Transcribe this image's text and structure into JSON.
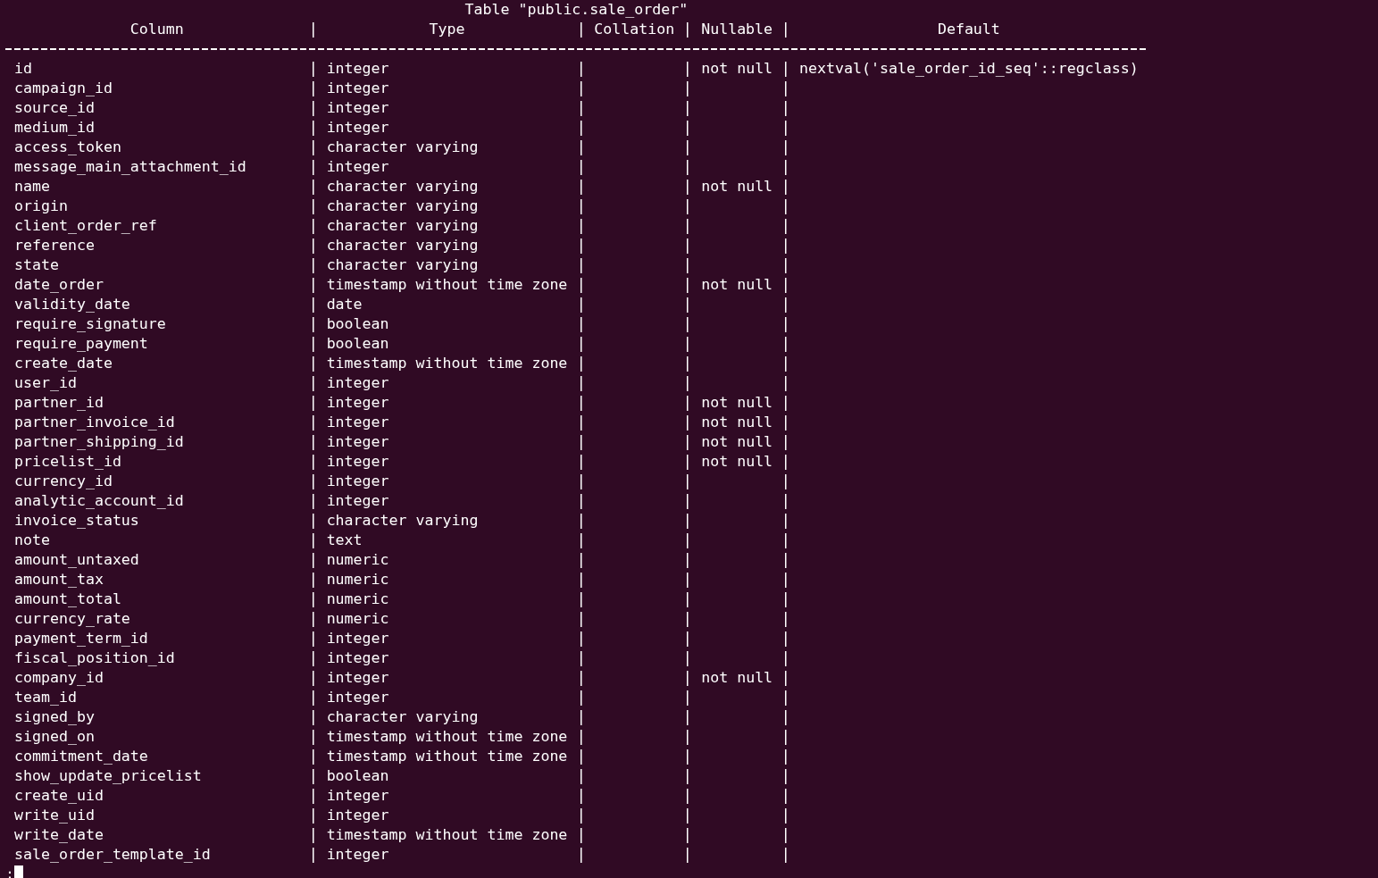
{
  "title": "Table \"public.sale_order\"",
  "columns": [
    "Column",
    "Type",
    "Collation",
    "Nullable",
    "Default"
  ],
  "rows": [
    {
      "column": "id",
      "type": "integer",
      "nullable": "not null",
      "default": "nextval('sale_order_id_seq'::regclass)"
    },
    {
      "column": "campaign_id",
      "type": "integer"
    },
    {
      "column": "source_id",
      "type": "integer"
    },
    {
      "column": "medium_id",
      "type": "integer"
    },
    {
      "column": "access_token",
      "type": "character varying"
    },
    {
      "column": "message_main_attachment_id",
      "type": "integer"
    },
    {
      "column": "name",
      "type": "character varying",
      "nullable": "not null"
    },
    {
      "column": "origin",
      "type": "character varying"
    },
    {
      "column": "client_order_ref",
      "type": "character varying"
    },
    {
      "column": "reference",
      "type": "character varying"
    },
    {
      "column": "state",
      "type": "character varying"
    },
    {
      "column": "date_order",
      "type": "timestamp without time zone",
      "nullable": "not null"
    },
    {
      "column": "validity_date",
      "type": "date"
    },
    {
      "column": "require_signature",
      "type": "boolean"
    },
    {
      "column": "require_payment",
      "type": "boolean"
    },
    {
      "column": "create_date",
      "type": "timestamp without time zone"
    },
    {
      "column": "user_id",
      "type": "integer"
    },
    {
      "column": "partner_id",
      "type": "integer",
      "nullable": "not null"
    },
    {
      "column": "partner_invoice_id",
      "type": "integer",
      "nullable": "not null"
    },
    {
      "column": "partner_shipping_id",
      "type": "integer",
      "nullable": "not null"
    },
    {
      "column": "pricelist_id",
      "type": "integer",
      "nullable": "not null"
    },
    {
      "column": "currency_id",
      "type": "integer"
    },
    {
      "column": "analytic_account_id",
      "type": "integer"
    },
    {
      "column": "invoice_status",
      "type": "character varying"
    },
    {
      "column": "note",
      "type": "text"
    },
    {
      "column": "amount_untaxed",
      "type": "numeric"
    },
    {
      "column": "amount_tax",
      "type": "numeric"
    },
    {
      "column": "amount_total",
      "type": "numeric"
    },
    {
      "column": "currency_rate",
      "type": "numeric"
    },
    {
      "column": "payment_term_id",
      "type": "integer"
    },
    {
      "column": "fiscal_position_id",
      "type": "integer"
    },
    {
      "column": "company_id",
      "type": "integer",
      "nullable": "not null"
    },
    {
      "column": "team_id",
      "type": "integer"
    },
    {
      "column": "signed_by",
      "type": "character varying"
    },
    {
      "column": "signed_on",
      "type": "timestamp without time zone"
    },
    {
      "column": "commitment_date",
      "type": "timestamp without time zone"
    },
    {
      "column": "show_update_pricelist",
      "type": "boolean"
    },
    {
      "column": "create_uid",
      "type": "integer"
    },
    {
      "column": "write_uid",
      "type": "integer"
    },
    {
      "column": "write_date",
      "type": "timestamp without time zone"
    },
    {
      "column": "sale_order_template_id",
      "type": "integer"
    }
  ],
  "prompt": ":"
}
